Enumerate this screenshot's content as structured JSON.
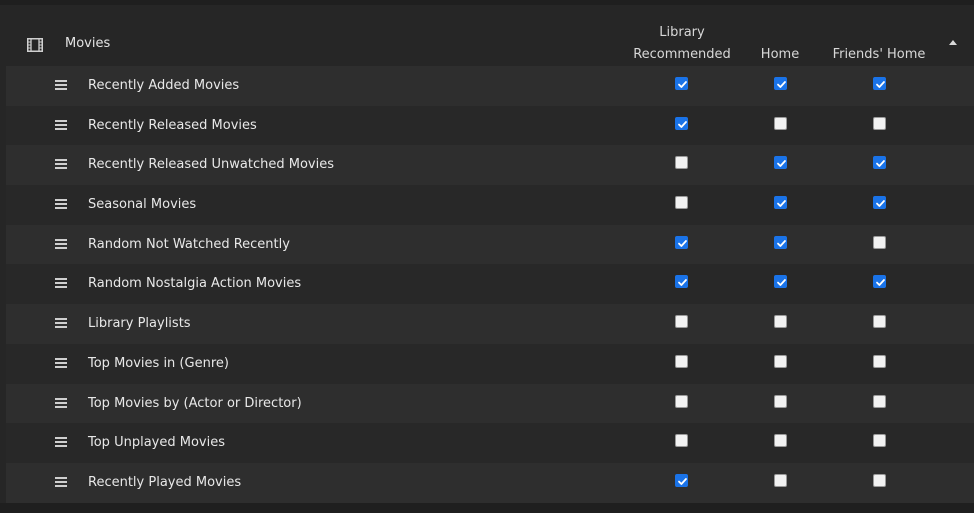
{
  "section": {
    "title": "Movies",
    "icon": "film-icon"
  },
  "columns": {
    "library_recommended": [
      "Library",
      "Recommended"
    ],
    "home": "Home",
    "friends_home": "Friends' Home"
  },
  "colors": {
    "checked": "#1a73e8",
    "background": "#262626",
    "row_alt": "#2e2e2e"
  },
  "rows": [
    {
      "label": "Recently Added Movies",
      "library_recommended": true,
      "home": true,
      "friends_home": true
    },
    {
      "label": "Recently Released Movies",
      "library_recommended": true,
      "home": false,
      "friends_home": false
    },
    {
      "label": "Recently Released Unwatched Movies",
      "library_recommended": false,
      "home": true,
      "friends_home": true
    },
    {
      "label": "Seasonal Movies",
      "library_recommended": false,
      "home": true,
      "friends_home": true
    },
    {
      "label": "Random Not Watched Recently",
      "library_recommended": true,
      "home": true,
      "friends_home": false
    },
    {
      "label": "Random Nostalgia Action Movies",
      "library_recommended": true,
      "home": true,
      "friends_home": true
    },
    {
      "label": "Library Playlists",
      "library_recommended": false,
      "home": false,
      "friends_home": false
    },
    {
      "label": "Top Movies in (Genre)",
      "library_recommended": false,
      "home": false,
      "friends_home": false
    },
    {
      "label": "Top Movies by (Actor or Director)",
      "library_recommended": false,
      "home": false,
      "friends_home": false
    },
    {
      "label": "Top Unplayed Movies",
      "library_recommended": false,
      "home": false,
      "friends_home": false
    },
    {
      "label": "Recently Played Movies",
      "library_recommended": true,
      "home": false,
      "friends_home": false
    }
  ]
}
